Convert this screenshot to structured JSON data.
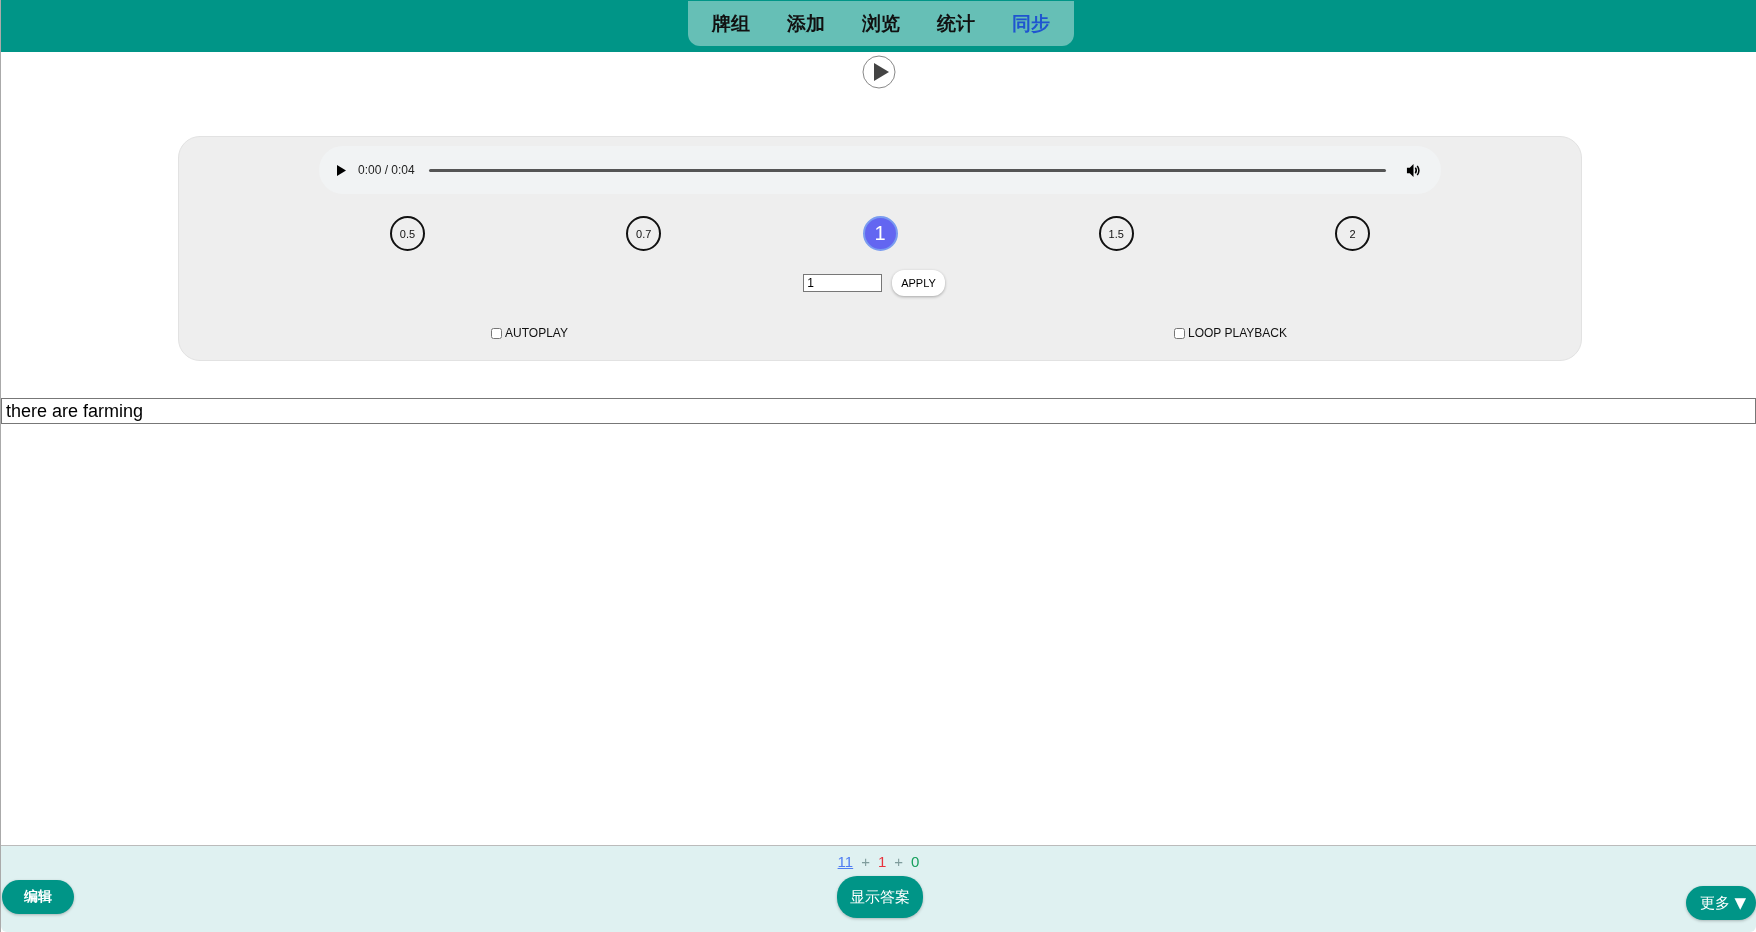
{
  "nav": {
    "tabs": [
      {
        "label": "牌组",
        "selected": false
      },
      {
        "label": "添加",
        "selected": false
      },
      {
        "label": "浏览",
        "selected": false
      },
      {
        "label": "统计",
        "selected": false
      },
      {
        "label": "同步",
        "selected": true
      }
    ]
  },
  "audio": {
    "time": "0:00 / 0:04"
  },
  "speeds": [
    {
      "label": "0.5",
      "selected": false
    },
    {
      "label": "0.7",
      "selected": false
    },
    {
      "label": "1",
      "selected": true
    },
    {
      "label": "1.5",
      "selected": false
    },
    {
      "label": "2",
      "selected": false
    }
  ],
  "rate_input": {
    "value": "1"
  },
  "apply_button": "APPLY",
  "options": [
    {
      "label": "AUTOPLAY",
      "checked": false
    },
    {
      "label": "LOOP PLAYBACK",
      "checked": false
    }
  ],
  "answer_field": {
    "value": "there are farming"
  },
  "counts": [
    {
      "kind": "link",
      "text": "11",
      "color": "#4f7df3"
    },
    {
      "kind": "plus",
      "text": "+"
    },
    {
      "kind": "count",
      "text": "1",
      "color": "#e8323c"
    },
    {
      "kind": "plus",
      "text": "+"
    },
    {
      "kind": "count",
      "text": "0",
      "color": "#17a05d"
    }
  ],
  "buttons": {
    "edit": "编辑",
    "show_answer": "显示答案",
    "more": "更多 ▼"
  }
}
